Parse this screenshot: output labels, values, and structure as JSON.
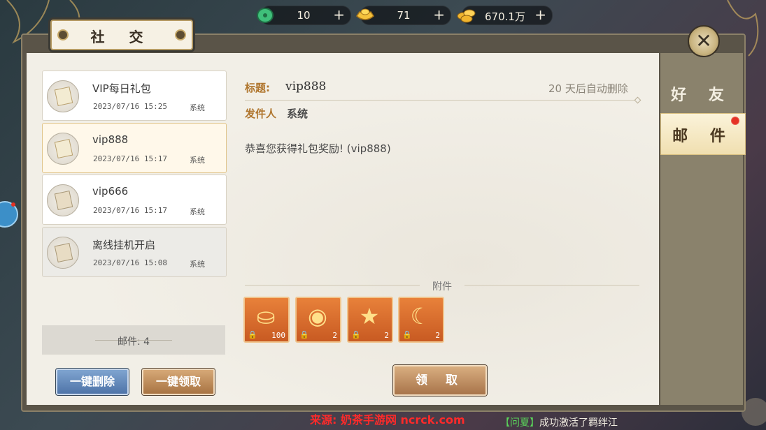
{
  "resources": [
    {
      "icon": "jade-icon",
      "value": "10"
    },
    {
      "icon": "gold-ingot-icon",
      "value": "71"
    },
    {
      "icon": "coins-icon",
      "value": "670.1万"
    }
  ],
  "window": {
    "title": "社 交"
  },
  "tabs": {
    "friends": "好 友",
    "mail": "邮 件"
  },
  "mails": [
    {
      "title": "VIP每日礼包",
      "date": "2023/07/16 15:25",
      "sender": "系统"
    },
    {
      "title": "vip888",
      "date": "2023/07/16 15:17",
      "sender": "系统"
    },
    {
      "title": "vip666",
      "date": "2023/07/16 15:17",
      "sender": "系统"
    },
    {
      "title": "离线挂机开启",
      "date": "2023/07/16 15:08",
      "sender": "系统"
    }
  ],
  "mail_count": "邮件: 4",
  "buttons": {
    "delete_all": "一键删除",
    "claim_all": "一键领取",
    "claim": "领 取"
  },
  "detail": {
    "title_label": "标题:",
    "title": "vip888",
    "expire": "20 天后自动删除",
    "sender_label": "发件人",
    "sender": "系统",
    "body": "恭喜您获得礼包奖励! (vip888)",
    "attachments_label": "附件",
    "attachments": [
      {
        "icon": "gold-ingot-icon",
        "qty": "100"
      },
      {
        "icon": "orb-icon",
        "qty": "2"
      },
      {
        "icon": "star-icon",
        "qty": "2"
      },
      {
        "icon": "moon-icon",
        "qty": "2"
      }
    ]
  },
  "footer": {
    "source": "来源: 奶茶手游网 ncrck.com",
    "news_tag": "【问夏】",
    "news": "成功激活了羁绊江"
  },
  "colors": {
    "accent_gold": "#b0762e",
    "notify_red": "#e53225",
    "panel_bg": "#f2efe7"
  }
}
